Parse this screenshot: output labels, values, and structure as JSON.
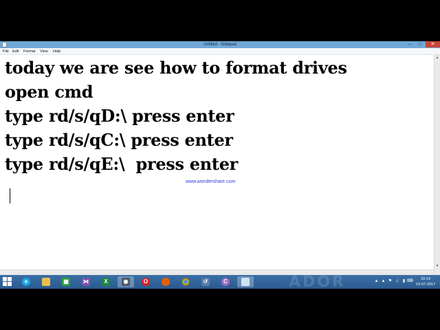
{
  "window": {
    "title": "Untitled - Notepad"
  },
  "menu": [
    "File",
    "Edit",
    "Format",
    "View",
    "Help"
  ],
  "document": {
    "lines": [
      "today we are see how to format drives",
      "open cmd",
      "type rd/s/qD:\\ press enter",
      "type rd/s/qC:\\ press enter",
      "type rd/s/qE:\\  press enter"
    ]
  },
  "watermark": "www.wondershare.com",
  "taskbar": {
    "pinned_icons": [
      "windows-start-icon",
      "internet-explorer-icon",
      "file-explorer-icon",
      "store-icon",
      "visual-studio-icon",
      "excel-icon",
      "camera-app-icon",
      "opera-icon",
      "firefox-icon",
      "chrome-icon",
      "tool-app-icon",
      "media-app-icon",
      "notepad-icon"
    ],
    "decorative_text": "ADOR"
  },
  "tray": {
    "time": "16:14",
    "date": "23-07-2017"
  }
}
